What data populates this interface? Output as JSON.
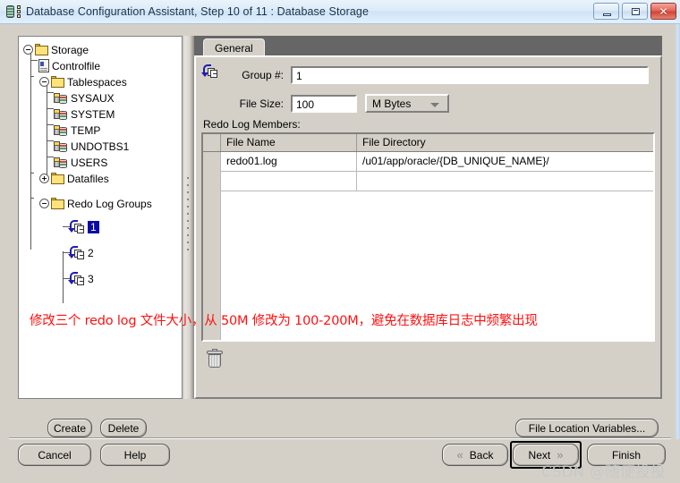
{
  "window": {
    "title": "Database Configuration Assistant, Step 10 of 11 : Database Storage",
    "app_icon": "database-icon",
    "buttons": {
      "minimize": "minimize-icon",
      "maximize": "maximize-icon",
      "close": "✕"
    }
  },
  "tree": {
    "nodes": [
      {
        "label": "Storage",
        "icon": "folder-icon",
        "depth": 0,
        "expander": "collapse",
        "selected": false
      },
      {
        "label": "Controlfile",
        "icon": "controlfile-icon",
        "depth": 1,
        "expander": "none",
        "selected": false
      },
      {
        "label": "Tablespaces",
        "icon": "folder-icon",
        "depth": 1,
        "expander": "collapse",
        "selected": false
      },
      {
        "label": "SYSAUX",
        "icon": "tablespace-icon",
        "depth": 2,
        "expander": "none",
        "selected": false
      },
      {
        "label": "SYSTEM",
        "icon": "tablespace-icon",
        "depth": 2,
        "expander": "none",
        "selected": false
      },
      {
        "label": "TEMP",
        "icon": "tablespace-icon",
        "depth": 2,
        "expander": "none",
        "selected": false
      },
      {
        "label": "UNDOTBS1",
        "icon": "tablespace-icon",
        "depth": 2,
        "expander": "none",
        "selected": false
      },
      {
        "label": "USERS",
        "icon": "tablespace-icon",
        "depth": 2,
        "expander": "none",
        "selected": false
      },
      {
        "label": "Datafiles",
        "icon": "folder-icon",
        "depth": 1,
        "expander": "expand",
        "selected": false
      },
      {
        "label": "Redo Log Groups",
        "icon": "folder-icon",
        "depth": 1,
        "expander": "collapse",
        "selected": false
      },
      {
        "label": "1",
        "icon": "redo-log-group-icon",
        "depth": 2,
        "expander": "none",
        "selected": true
      },
      {
        "label": "2",
        "icon": "redo-log-group-icon",
        "depth": 2,
        "expander": "none",
        "selected": false
      },
      {
        "label": "3",
        "icon": "redo-log-group-icon",
        "depth": 2,
        "expander": "none",
        "selected": false
      }
    ]
  },
  "left_buttons": {
    "create": "Create",
    "delete": "Delete"
  },
  "tabs": {
    "general": "General"
  },
  "form": {
    "group_label": "Group #:",
    "group_value": "1",
    "file_size_label": "File Size:",
    "file_size_value": "100",
    "file_size_unit": "M Bytes",
    "members_label": "Redo Log Members:"
  },
  "members_table": {
    "columns": [
      "File Name",
      "File Directory"
    ],
    "rows": [
      {
        "file_name": "redo01.log",
        "file_directory": "/u01/app/oracle/{DB_UNIQUE_NAME}/"
      },
      {
        "file_name": "",
        "file_directory": ""
      }
    ],
    "delete_icon": "trash-icon"
  },
  "right_buttons": {
    "file_location_variables": "File Location Variables..."
  },
  "nav": {
    "cancel": "Cancel",
    "help": "Help",
    "back": "Back",
    "back_icon": "«",
    "next": "Next",
    "next_icon": "»",
    "finish": "Finish"
  },
  "annotation": {
    "text": "修改三个 redo log 文件大小，从 50M 修改为 100-200M，避免在数据库日志中频繁出现",
    "color": "#fe1111"
  },
  "watermark": {
    "text": "CSDN @随便投投"
  }
}
